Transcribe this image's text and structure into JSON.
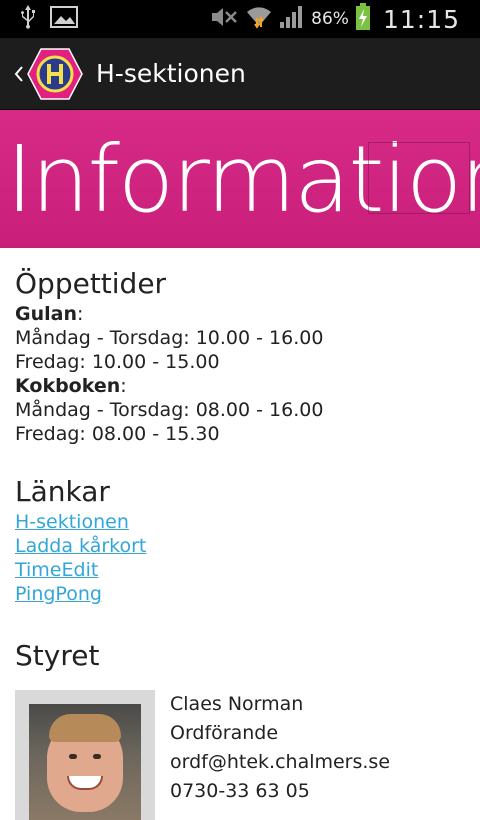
{
  "status_bar": {
    "battery": "86%",
    "time": "11:15",
    "icons": [
      "usb-icon",
      "image-icon",
      "mute-icon",
      "wifi-icon",
      "signal-icon",
      "battery-charging-icon"
    ]
  },
  "action_bar": {
    "title": "H-sektionen",
    "logo": "h-sektionen-logo"
  },
  "banner": {
    "title": "Information"
  },
  "opening_hours": {
    "heading": "Öppettider",
    "places": [
      {
        "name": "Gulan",
        "suffix": ":",
        "lines": [
          "Måndag - Torsdag: 10.00 - 16.00",
          "Fredag: 10.00 - 15.00"
        ]
      },
      {
        "name": "Kokboken",
        "suffix": ":",
        "lines": [
          "Måndag - Torsdag: 08.00 - 16.00",
          "Fredag: 08.00 - 15.30"
        ]
      }
    ]
  },
  "links": {
    "heading": "Länkar",
    "items": [
      "H-sektionen",
      "Ladda kårkort",
      "TimeEdit",
      "PingPong"
    ]
  },
  "board": {
    "heading": "Styret",
    "members": [
      {
        "name": "Claes Norman",
        "role": "Ordförande",
        "email": "ordf@htek.chalmers.se",
        "phone": "0730-33 63 05"
      }
    ]
  },
  "colors": {
    "banner": "#d62a86",
    "link": "#33a6d8",
    "action_bar": "#1d1d1d"
  }
}
